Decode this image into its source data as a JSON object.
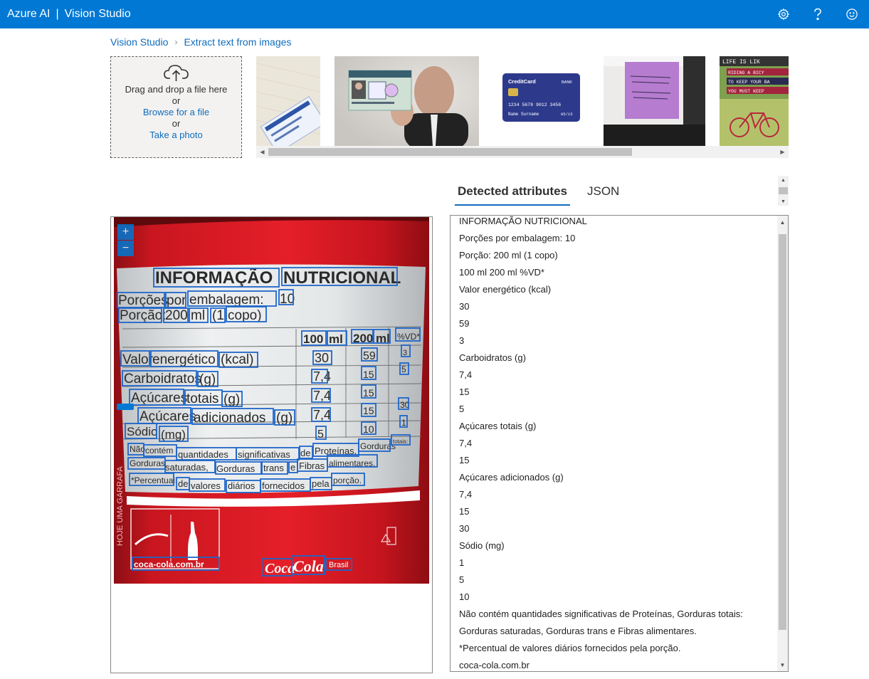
{
  "header": {
    "brand": "Azure AI",
    "divider": "|",
    "product": "Vision Studio",
    "icons": [
      "gear-icon",
      "help-icon",
      "smiley-feedback-icon"
    ]
  },
  "breadcrumb": {
    "home": "Vision Studio",
    "separator": "›",
    "current": "Extract text from images"
  },
  "upload": {
    "icon": "cloud-upload-icon",
    "drag_text": "Drag and drop a file here",
    "or1": "or",
    "browse": "Browse for a file",
    "or2": "or",
    "photo": "Take a photo"
  },
  "thumbnails": [
    {
      "name": "social-security-card"
    },
    {
      "name": "identity-card-man"
    },
    {
      "name": "credit-card",
      "texts": {
        "brand": "CreditCard",
        "bank": "BANK",
        "number": "1234 5678 9012 3456",
        "holder": "Name Surname",
        "expiry": "05/15"
      }
    },
    {
      "name": "sticky-note"
    },
    {
      "name": "life-is-like-poster",
      "texts": {
        "l1": "LIFE IS LIK",
        "l2": "RIDING A BICY",
        "l3": "TO KEEP YOUR BA",
        "l4": "YOU MUST KEEP"
      }
    }
  ],
  "tabs": {
    "detected": "Detected attributes",
    "json": "JSON"
  },
  "label_image": {
    "zoom_in": "+",
    "zoom_out": "−",
    "title_words": [
      "INFORMAÇÃO",
      "NUTRICIONAL"
    ],
    "rows": {
      "porcoes": [
        "Porções",
        "por",
        "embalagem:",
        "10"
      ],
      "porcao": [
        "Porção:",
        "200",
        "ml",
        "(1",
        "copo)"
      ],
      "headers": [
        "100",
        "ml",
        "200",
        "ml",
        "%VD*"
      ],
      "valor": [
        "Valor",
        "energético",
        "(kcal)",
        "30",
        "59",
        "3"
      ],
      "carbo": [
        "Carboidratos",
        "(g)",
        "7,4",
        "15",
        "5"
      ],
      "acucares": [
        "Açúcares",
        "totais",
        "(g)",
        "7,4",
        "15"
      ],
      "adicionados": [
        "Açúcares",
        "adicionados",
        "(g)",
        "7,4",
        "15",
        "30"
      ],
      "sodio": [
        "Sódio",
        "(mg)",
        "5",
        "10",
        "1"
      ],
      "foot1": [
        "Não",
        "contém",
        "quantidades",
        "significativas",
        "de",
        "Proteínas,",
        "Gorduras",
        "totais:"
      ],
      "foot2": [
        "Gorduras",
        "saturadas,",
        "Gorduras",
        "trans",
        "e",
        "Fibras",
        "alimentares."
      ],
      "foot3": [
        "*Percentual",
        "de",
        "valores",
        "diários",
        "fornecidos",
        "pela",
        "porção."
      ]
    },
    "site": "coca-cola.com.br",
    "logo1": "Coca",
    "logo2": "Cola",
    "brasil": "Brasil",
    "side_text": "HOJE UMA GARRAFA"
  },
  "results": [
    "INFORMAÇÃO NUTRICIONAL",
    "Porções por embalagem: 10",
    "Porção: 200 ml (1 copo)",
    "100 ml 200 ml %VD*",
    "Valor energético (kcal)",
    "30",
    "59",
    "3",
    "Carboidratos (g)",
    "7,4",
    "15",
    "5",
    "Açúcares totais (g)",
    "7,4",
    "15",
    "Açúcares adicionados (g)",
    "7,4",
    "15",
    "30",
    "Sódio (mg)",
    "1",
    "5",
    "10",
    "Não contém quantidades significativas de Proteínas, Gorduras totais:",
    "Gorduras saturadas, Gorduras trans e Fibras alimentares.",
    "*Percentual de valores diários fornecidos pela porção.",
    "coca-cola.com.br"
  ]
}
